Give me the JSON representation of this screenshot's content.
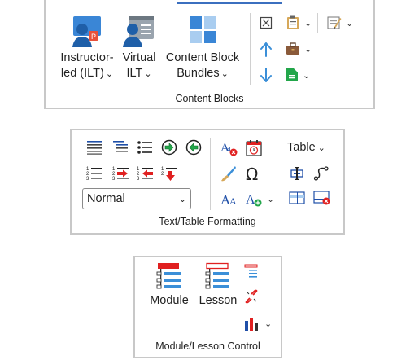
{
  "panel1": {
    "group_label": "Content Blocks",
    "instructor_led": {
      "line1": "Instructor-",
      "line2": "led (ILT)",
      "chevron": "⌄"
    },
    "virtual_ilt": {
      "line1": "Virtual",
      "line2": "ILT",
      "chevron": "⌄"
    },
    "content_block_bundles": {
      "line1": "Content Block",
      "line2": "Bundles",
      "chevron": "⌄"
    }
  },
  "panel2": {
    "group_label": "Text/Table Formatting",
    "style_select": {
      "value": "Normal",
      "options": [
        "Normal"
      ]
    },
    "table_button": {
      "label": "Table",
      "chevron": "⌄"
    },
    "omega_glyph": "Ω"
  },
  "panel3": {
    "group_label": "Module/Lesson Control",
    "module_label": "Module",
    "lesson_label": "Lesson"
  },
  "colors": {
    "accent_blue": "#3b8fd8",
    "red": "#e02020",
    "green": "#22a64a",
    "border": "#c8c8c8"
  }
}
